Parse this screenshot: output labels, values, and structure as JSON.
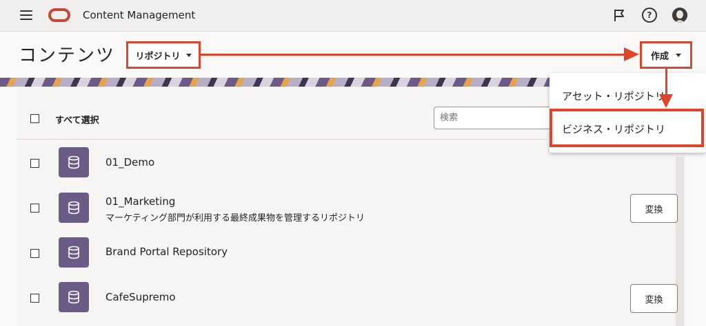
{
  "header": {
    "app_title": "Content Management",
    "icons": [
      "menu-icon",
      "oracle-logo",
      "flag-icon",
      "help-icon",
      "avatar"
    ],
    "help_glyph": "?"
  },
  "page": {
    "title": "コンテンツ",
    "repository_dropdown": "リポジトリ",
    "create_button": "作成"
  },
  "create_menu": {
    "items": [
      "アセット・リポジトリ",
      "ビジネス・リポジトリ"
    ]
  },
  "list": {
    "select_all_label": "すべて選択",
    "search_placeholder": "検索",
    "convert_label": "変換",
    "repositories": [
      {
        "name": "01_Demo",
        "description": "",
        "has_convert": false
      },
      {
        "name": "01_Marketing",
        "description": "マーケティング部門が利用する最終成果物を管理するリポジトリ",
        "has_convert": true
      },
      {
        "name": "Brand Portal Repository",
        "description": "",
        "has_convert": false
      },
      {
        "name": "CafeSupremo",
        "description": "",
        "has_convert": true
      }
    ]
  },
  "colors": {
    "annotation_red": "#e0452b",
    "repo_icon_purple": "#6b5b87",
    "brand_red": "#c74634"
  }
}
